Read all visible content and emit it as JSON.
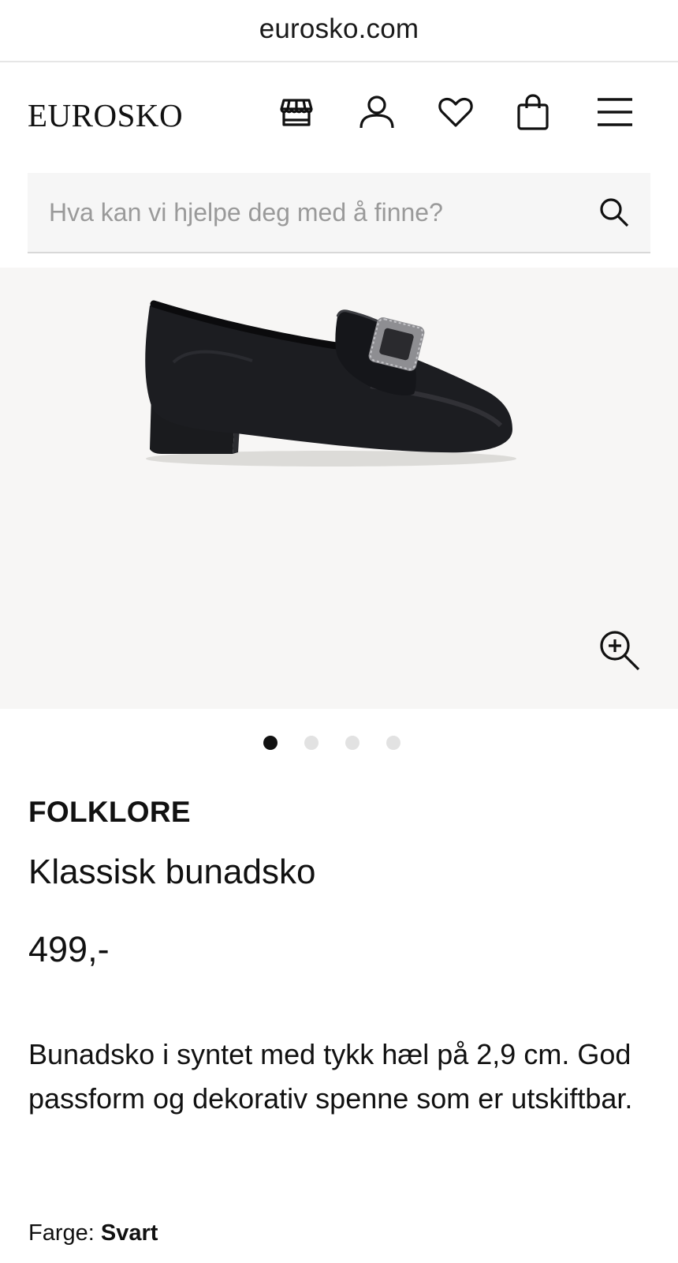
{
  "browser": {
    "url": "eurosko.com"
  },
  "header": {
    "logo": "EUROSKO",
    "icons": [
      "store-icon",
      "account-icon",
      "wishlist-heart-icon",
      "shopping-bag-icon",
      "hamburger-menu-icon"
    ]
  },
  "search": {
    "placeholder": "Hva kan vi hjelpe deg med å finne?",
    "value": ""
  },
  "gallery": {
    "image_count": 4,
    "active_index": 0
  },
  "product": {
    "brand": "FOLKLORE",
    "name": "Klassisk bunadsko",
    "price": "499,-",
    "description": "Bunadsko i syntet med tykk hæl på 2,9 cm. God passform og dekorativ spenne som er utskiftbar.",
    "color_label": "Farge:",
    "color_value": "Svart"
  },
  "colors": {
    "text": "#111111",
    "search_bg": "#f6f6f6",
    "gallery_bg": "#f7f6f5",
    "dot_inactive": "#e2e2e2"
  }
}
